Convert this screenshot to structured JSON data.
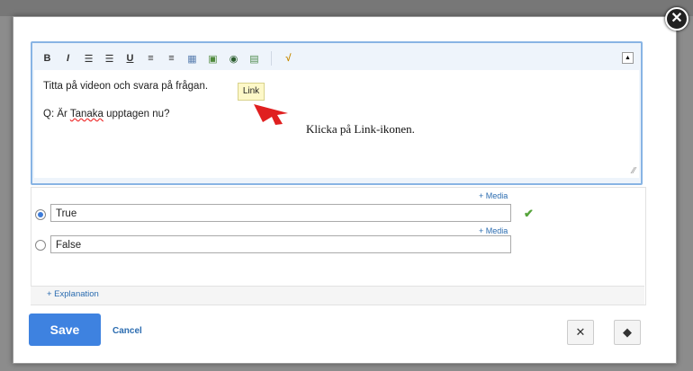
{
  "editor": {
    "toolbar": [
      {
        "icon": "bold-icon",
        "glyph": "B"
      },
      {
        "icon": "italic-icon",
        "glyph": "I"
      },
      {
        "icon": "ordered-list-icon",
        "glyph": "☰"
      },
      {
        "icon": "bullet-list-icon",
        "glyph": "☰"
      },
      {
        "icon": "underline-icon",
        "glyph": "U"
      },
      {
        "icon": "align-left-icon",
        "glyph": "≡"
      },
      {
        "icon": "align-right-icon",
        "glyph": "≡"
      },
      {
        "icon": "table-icon",
        "glyph": "▦"
      },
      {
        "icon": "image-icon",
        "glyph": "▣"
      },
      {
        "icon": "link-icon",
        "glyph": "◉"
      },
      {
        "icon": "document-icon",
        "glyph": "▤"
      },
      {
        "icon": "math-icon",
        "glyph": "√"
      }
    ],
    "line1": "Titta på videon och svara på frågan.",
    "line2_prefix": "Q: Är ",
    "line2_name": "Tanaka",
    "line2_suffix": " upptagen nu?"
  },
  "tooltip": "Link",
  "callout": "Klicka på Link-ikonen.",
  "answers": {
    "media_label": "+ Media",
    "true_value": "True",
    "false_value": "False",
    "explanation_label": "+ Explanation"
  },
  "footer": {
    "save": "Save",
    "cancel": "Cancel"
  }
}
